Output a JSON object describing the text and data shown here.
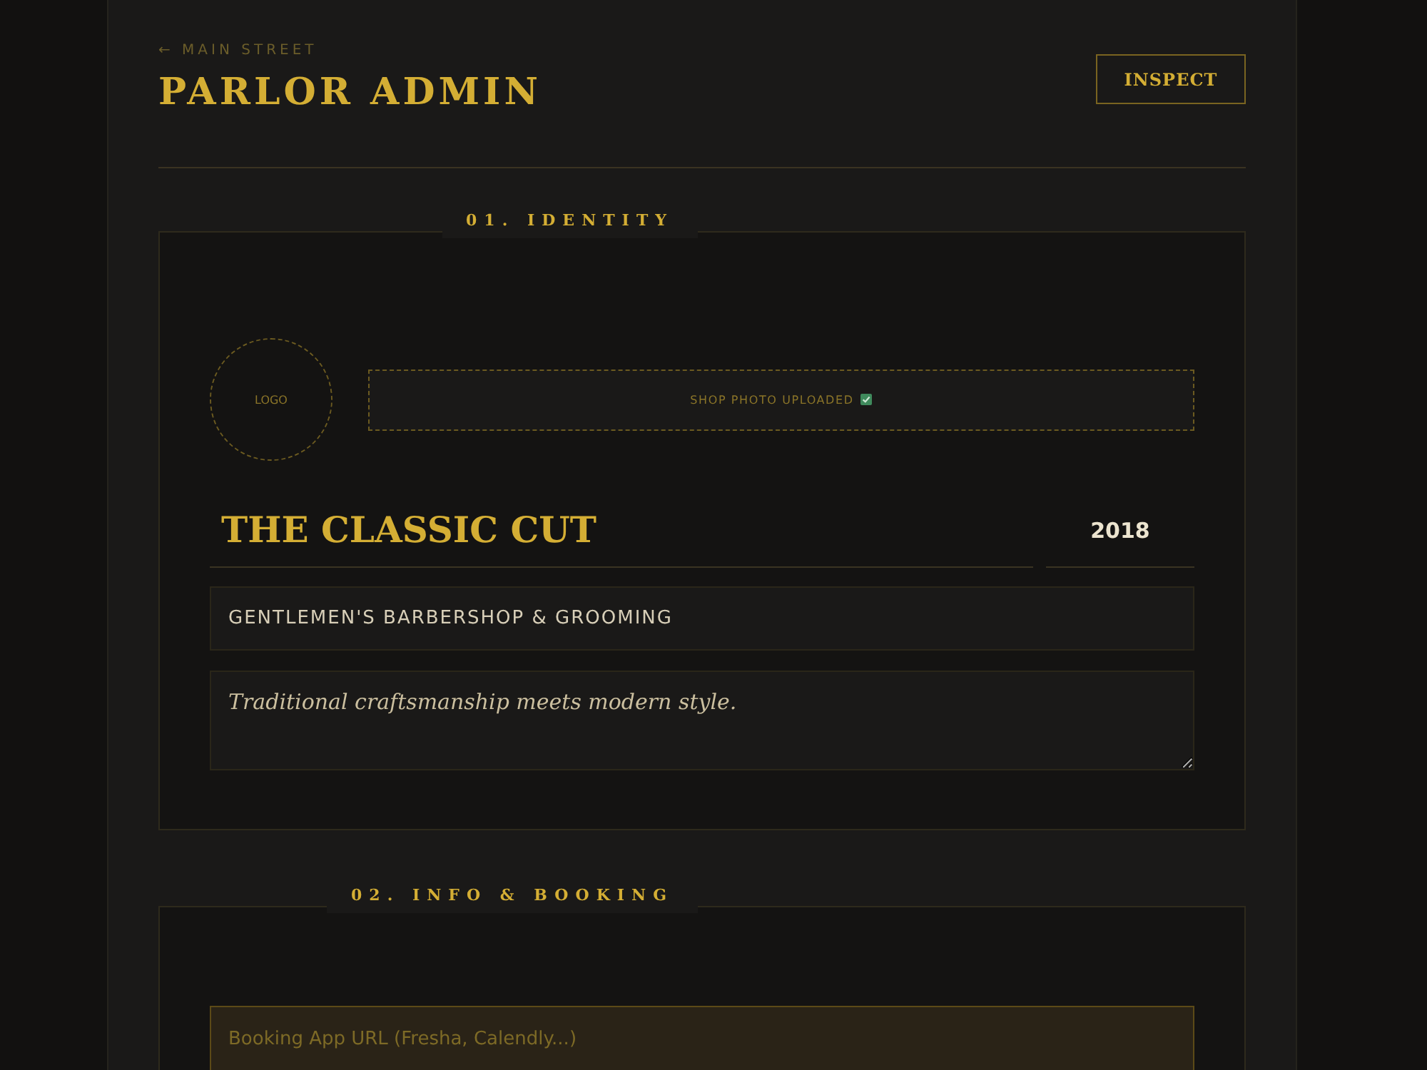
{
  "header": {
    "back_link": "← MAIN STREET",
    "title": "PARLOR ADMIN",
    "inspect_button": "INSPECT"
  },
  "identity": {
    "legend": "01. IDENTITY",
    "logo": "LOGO",
    "photo": {
      "label": "SHOP PHOTO UPLOADED",
      "uploaded": true
    },
    "shop_name": "THE CLASSIC CUT",
    "year": "2018",
    "tagline": "GENTLEMEN'S BARBERSHOP & GROOMING",
    "description": "Traditional craftsmanship meets modern style."
  },
  "booking": {
    "legend": "02. INFO & BOOKING",
    "booking_url": {
      "placeholder": "Booking App URL (Fresha, Calendly...)"
    }
  }
}
